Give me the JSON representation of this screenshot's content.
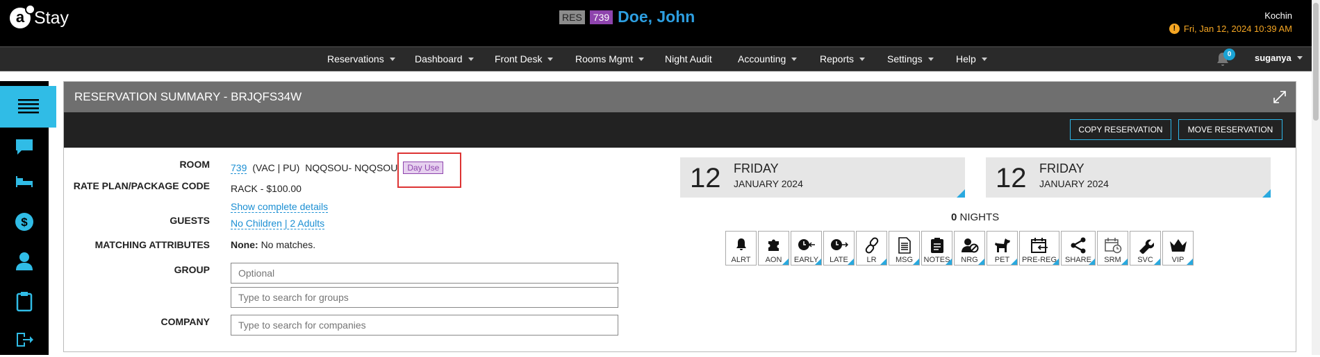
{
  "app": {
    "brand": "Stay",
    "logo_letter": "a"
  },
  "header": {
    "res_tag": "RES",
    "room_tag": "739",
    "guest_name": "Doe, John",
    "city": "Kochin",
    "datetime": "Fri, Jan 12, 2024 10:39 AM",
    "warn_icon": "!"
  },
  "nav": {
    "items": [
      {
        "label": "Reservations",
        "dropdown": true
      },
      {
        "label": "Dashboard",
        "dropdown": true
      },
      {
        "label": "Front Desk",
        "dropdown": true
      },
      {
        "label": "Rooms Mgmt",
        "dropdown": true
      },
      {
        "label": "Night Audit",
        "dropdown": false
      },
      {
        "label": "Accounting",
        "dropdown": true
      },
      {
        "label": "Reports",
        "dropdown": true
      },
      {
        "label": "Settings",
        "dropdown": true
      },
      {
        "label": "Help",
        "dropdown": true
      }
    ],
    "notifications": "0",
    "user": "suganya"
  },
  "sidebar": {
    "icons": [
      "menu-icon",
      "chat-icon",
      "bed-icon",
      "dollar-icon",
      "person-icon",
      "clipboard-icon",
      "export-icon"
    ]
  },
  "panel": {
    "title": "RESERVATION SUMMARY - BRJQFS34W",
    "copy_label": "COPY RESERVATION",
    "move_label": "MOVE RESERVATION"
  },
  "details": {
    "room_label": "ROOM",
    "room_number": "739",
    "room_status": "(VAC | PU)",
    "room_type": "NQQSOU- NQQSOU",
    "day_use": "Day Use",
    "rate_label": "RATE PLAN/PACKAGE CODE",
    "rate_value": "RACK - $100.00",
    "show_details": "Show complete details",
    "guests_label": "GUESTS",
    "guests_value": "No Children | 2 Adults",
    "matching_label": "MATCHING ATTRIBUTES",
    "matching_none": "None:",
    "matching_value": "No matches.",
    "group_label": "GROUP",
    "group_placeholder": "Optional",
    "group_search_placeholder": "Type to search for groups",
    "company_label": "COMPANY",
    "company_placeholder": "Type to search for companies"
  },
  "dates": {
    "arrival": {
      "day": "12",
      "weekday": "FRIDAY",
      "month_year": "JANUARY 2024"
    },
    "departure": {
      "day": "12",
      "weekday": "FRIDAY",
      "month_year": "JANUARY 2024"
    },
    "nights_count": "0",
    "nights_label": "NIGHTS"
  },
  "quick_icons": [
    {
      "label": "ALRT",
      "icon": "bell-icon",
      "flag": false
    },
    {
      "label": "AON",
      "icon": "puzzle-icon",
      "flag": true
    },
    {
      "label": "EARLY",
      "icon": "clock-early-icon",
      "flag": true
    },
    {
      "label": "LATE",
      "icon": "clock-late-icon",
      "flag": true
    },
    {
      "label": "LR",
      "icon": "link-icon",
      "flag": true
    },
    {
      "label": "MSG",
      "icon": "document-icon",
      "flag": true
    },
    {
      "label": "NOTES",
      "icon": "notes-icon",
      "flag": true
    },
    {
      "label": "NRG",
      "icon": "no-person-icon",
      "flag": true
    },
    {
      "label": "PET",
      "icon": "dog-icon",
      "flag": true
    },
    {
      "label": "PRE-REG",
      "icon": "calendar-arrow-icon",
      "flag": true
    },
    {
      "label": "SHARE",
      "icon": "share-icon",
      "flag": true
    },
    {
      "label": "SRM",
      "icon": "calendar-clock-icon",
      "flag": true
    },
    {
      "label": "SVC",
      "icon": "wrench-icon",
      "flag": true
    },
    {
      "label": "VIP",
      "icon": "crown-icon",
      "flag": true
    }
  ],
  "colors": {
    "accent": "#30bce6",
    "guest_name": "#2d9ee0",
    "warning": "#f5a623",
    "day_use": "#8e44ad",
    "highlight": "#dd3333"
  }
}
